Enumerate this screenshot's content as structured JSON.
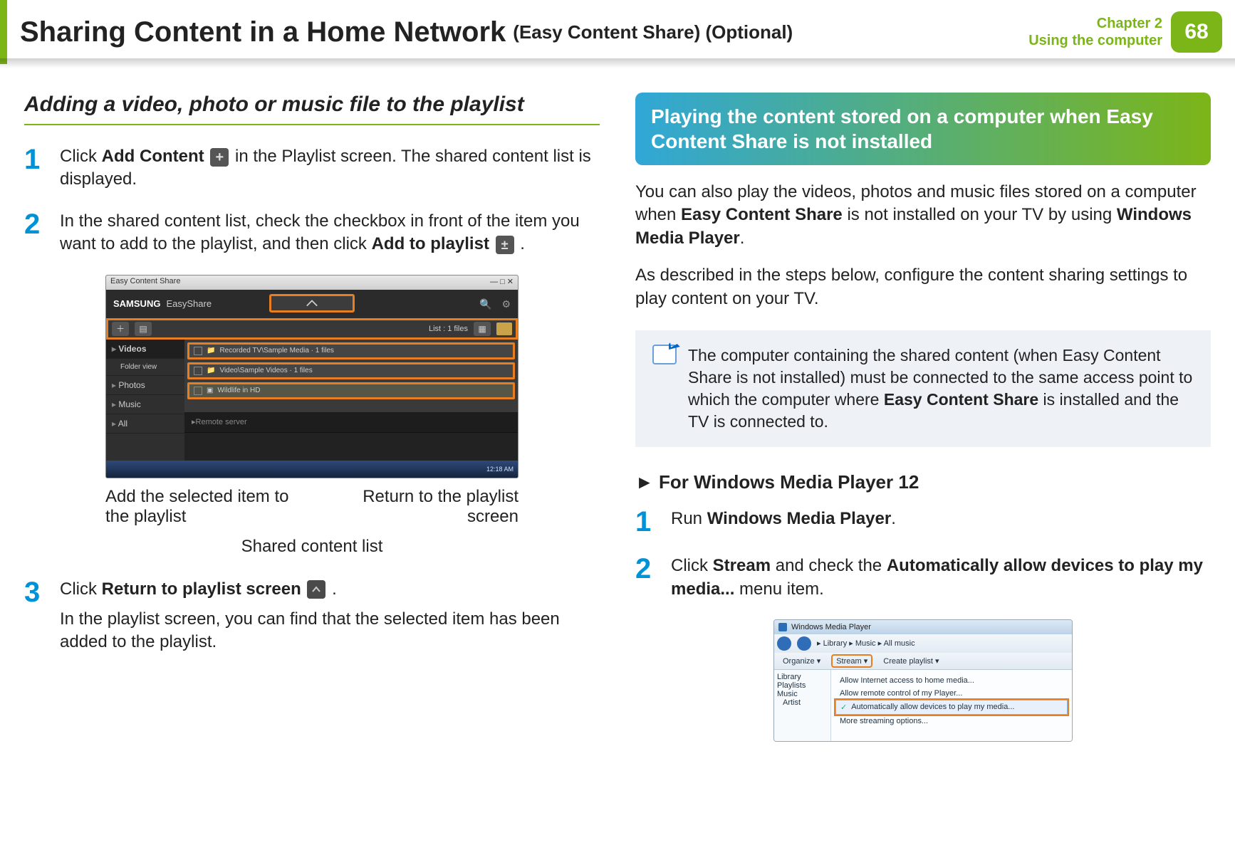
{
  "header": {
    "title_main": "Sharing Content in a Home Network",
    "title_sub": "(Easy Content Share) (Optional)",
    "chapter_line1": "Chapter 2",
    "chapter_line2": "Using the computer",
    "page_number": "68"
  },
  "left": {
    "heading": "Adding a video, photo or music file to the playlist",
    "step1": {
      "num": "1",
      "pre": "Click ",
      "bold1": "Add Content",
      "post": " in the Playlist screen. The shared content list is displayed."
    },
    "step2": {
      "num": "2",
      "pre": "In the shared content list, check the checkbox in front of the item you want to add to the playlist, and then click ",
      "bold1": "Add to playlist",
      "post": " ."
    },
    "shot": {
      "win_title": "Easy Content Share",
      "brand1": "SAMSUNG",
      "brand2": "EasyShare",
      "tool_count": "List : 1 files",
      "side_videos": "Videos",
      "side_folder": "Folder view",
      "side_photos": "Photos",
      "side_music": "Music",
      "side_all": "All",
      "side_remote": "Remote server",
      "row1": "Recorded TV\\Sample Media · 1 files",
      "row2": "Video\\Sample Videos · 1 files",
      "row3": "Wildlife in HD",
      "clock": "12:18 AM"
    },
    "callout_left": "Add the selected item to the playlist",
    "callout_right": "Return to the playlist screen",
    "callout_center": "Shared content list",
    "step3": {
      "num": "3",
      "pre": "Click ",
      "bold1": "Return to playlist screen",
      "post": " .",
      "para2": "In the playlist screen, you can find that the selected item has been added to the playlist."
    }
  },
  "right": {
    "banner": "Playing the content stored on a computer when Easy Content Share is not installed",
    "para1_pre": "You can also play the videos, photos and music files stored on a computer when ",
    "para1_b1": "Easy Content Share",
    "para1_mid": " is not installed on your TV by using ",
    "para1_b2": "Windows Media Player",
    "para1_post": ".",
    "para2": "As described in the steps below, configure the content sharing settings to play content on your TV.",
    "note_pre": "The computer containing the shared content (when Easy Content Share is not installed) must be connected to the same access point to which the computer where ",
    "note_b": "Easy Content Share",
    "note_post": " is installed and the TV is connected to.",
    "subheading": "For Windows Media Player 12",
    "step1": {
      "num": "1",
      "pre": "Run ",
      "bold1": "Windows Media Player",
      "post": "."
    },
    "step2": {
      "num": "2",
      "pre": "Click ",
      "bold1": "Stream",
      "mid": " and check the ",
      "bold2": "Automatically allow devices to play my media...",
      "post": " menu item."
    },
    "wmp": {
      "title": "Windows Media Player",
      "crumb": "▸ Library ▸ Music ▸ All music",
      "organize": "Organize ▾",
      "stream": "Stream ▾",
      "create": "Create playlist ▾",
      "side_library": "Library",
      "side_playlists": "Playlists",
      "side_music": "Music",
      "side_artist": "Artist",
      "m1": "Allow Internet access to home media...",
      "m2": "Allow remote control of my Player...",
      "m3": "Automatically allow devices to play my media...",
      "m4": "More streaming options..."
    }
  }
}
